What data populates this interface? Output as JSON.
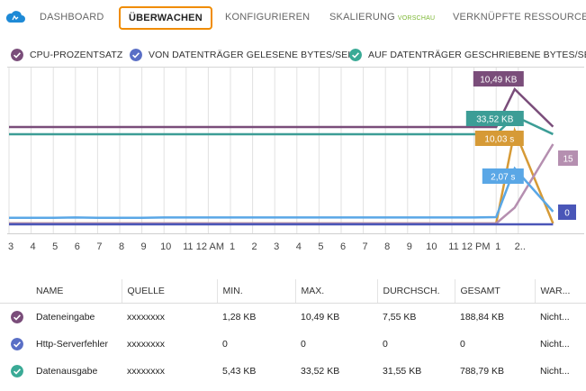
{
  "nav": {
    "tabs": [
      {
        "label": "DASHBOARD"
      },
      {
        "label": "ÜBERWACHEN"
      },
      {
        "label": "KONFIGURIEREN"
      },
      {
        "label": "SKALIERUNG",
        "badge": "VORSCHAU"
      },
      {
        "label": "VERKNÜPFTE RESSOURCEN"
      }
    ],
    "active_index": 1,
    "accent_color": "#f08c00",
    "badge_color": "#7cb733"
  },
  "legend": [
    {
      "label": "CPU-PROZENTSATZ",
      "color": "#7a4d7a",
      "icon": "check-circle-icon"
    },
    {
      "label": "VON DATENTRÄGER GELESENE BYTES/SEK.",
      "color": "#5a6fc6",
      "icon": "check-circle-icon"
    },
    {
      "label": "AUF DATENTRÄGER GESCHRIEBENE BYTES/SEK. ...",
      "color": "#3aaa96",
      "icon": "check-circle-icon"
    }
  ],
  "chart_data": {
    "type": "line",
    "x_ticks": [
      "3",
      "4",
      "5",
      "6",
      "7",
      "8",
      "9",
      "10",
      "11",
      "12 AM",
      "1",
      "2",
      "3",
      "4",
      "5",
      "6",
      "7",
      "8",
      "9",
      "10",
      "11",
      "12 PM",
      "1",
      "2.."
    ],
    "grid": true,
    "series": [
      {
        "color": "#7a4d7a",
        "values": [
          0.1,
          0.1,
          0.1,
          0.1,
          0.1,
          0.1,
          0.1,
          0.1,
          0.1,
          0.1,
          0.1,
          0.1,
          0.1,
          0.1,
          0.1,
          0.1,
          0.1,
          0.1,
          0.1,
          0.1,
          0.1,
          0.1,
          0.1,
          10.49,
          0.1
        ],
        "flag": "10,49 KB"
      },
      {
        "color": "#3c9d96",
        "values": [
          0.1,
          0.1,
          0.1,
          0.1,
          0.1,
          0.1,
          0.1,
          0.1,
          0.1,
          0.1,
          0.1,
          0.1,
          0.1,
          0.1,
          0.1,
          0.1,
          0.1,
          0.1,
          0.1,
          0.1,
          0.1,
          0.1,
          0.1,
          33.52,
          0.1
        ],
        "flag": "33,52 KB"
      },
      {
        "color": "#d69a36",
        "values": [
          0,
          0,
          0,
          0,
          0,
          0,
          0,
          0,
          0,
          0,
          0,
          0,
          0,
          0,
          0,
          0,
          0,
          0,
          0,
          0,
          0,
          0,
          0,
          10.03,
          0
        ],
        "flag": "10,03 s"
      },
      {
        "color": "#b58fb0",
        "values": [
          0,
          0,
          0,
          0,
          0,
          0,
          0,
          0,
          0,
          0,
          0,
          0,
          0,
          0,
          0,
          0,
          0,
          0,
          0,
          0,
          0,
          0,
          0,
          3,
          15
        ],
        "flag": "15"
      },
      {
        "color": "#5aa7e6",
        "values": [
          0.3,
          0.3,
          0.3,
          0.4,
          0.3,
          0.3,
          0.3,
          0.4,
          0.4,
          0.4,
          0.4,
          0.4,
          0.4,
          0.4,
          0.4,
          0.4,
          0.4,
          0.4,
          0.4,
          0.4,
          0.4,
          0.4,
          0.5,
          2.07,
          0.3
        ],
        "flag": "2,07 s"
      },
      {
        "color": "#4a56b8",
        "values": [
          0,
          0,
          0,
          0,
          0,
          0,
          0,
          0,
          0,
          0,
          0,
          0,
          0,
          0,
          0,
          0,
          0,
          0,
          0,
          0,
          0,
          0,
          0,
          0,
          0
        ],
        "flag": "0"
      }
    ]
  },
  "table": {
    "columns": [
      "NAME",
      "QUELLE",
      "MIN.",
      "MAX.",
      "DURCHSCH.",
      "GESAMT",
      "WAR..."
    ],
    "rows": [
      {
        "color": "#7a4d7a",
        "icon": "check-circle-icon",
        "cells": [
          "Dateneingabe",
          "xxxxxxxx",
          "1,28 KB",
          "10,49 KB",
          "7,55 KB",
          "188,84 KB",
          "Nicht..."
        ]
      },
      {
        "color": "#5a6fc6",
        "icon": "check-circle-icon",
        "cells": [
          "Http-Serverfehler",
          "xxxxxxxx",
          "0",
          "0",
          "0",
          "0",
          "Nicht..."
        ]
      },
      {
        "color": "#3aaa96",
        "icon": "check-circle-icon",
        "cells": [
          "Datenausgabe",
          "xxxxxxxx",
          "5,43 KB",
          "33,52 KB",
          "31,55 KB",
          "788,79 KB",
          "Nicht..."
        ]
      }
    ]
  }
}
